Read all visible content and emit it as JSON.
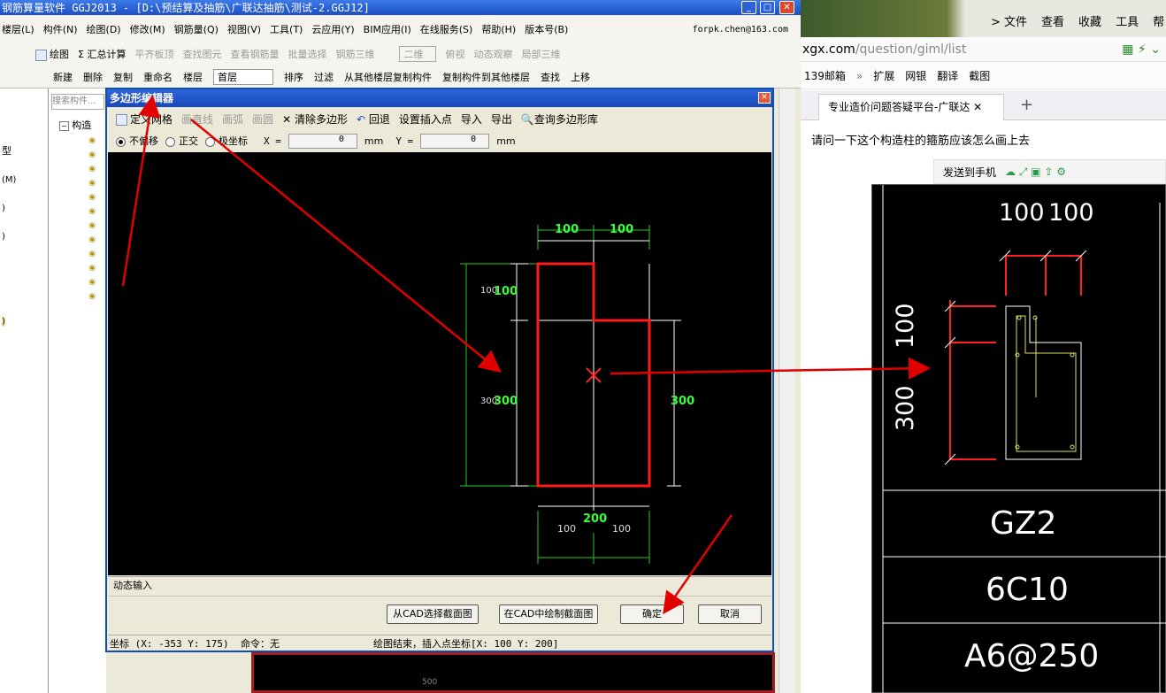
{
  "app": {
    "title": "钢筋算量软件 GGJ2013 - [D:\\预结算及抽筋\\广联达抽筋\\测试-2.GGJ12]",
    "menu": [
      "楼层(L)",
      "构件(N)",
      "绘图(D)",
      "修改(M)",
      "钢筋量(Q)",
      "视图(V)",
      "工具(T)",
      "云应用(Y)",
      "BIM应用(I)",
      "在线服务(S)",
      "帮助(H)",
      "版本号(B)"
    ],
    "account": "forpk.chen@163.com",
    "toolbar1": [
      "绘图",
      "Σ 汇总计算",
      "平齐板顶",
      "查找图元",
      "查看钢筋量",
      "批量选择",
      "钢筋三维",
      "二维",
      "俯视",
      "动态观察",
      "局部三维"
    ],
    "toolbar2": [
      "新建",
      "删除",
      "复制",
      "重命名",
      "楼层",
      "首层",
      "排序",
      "过滤",
      "从其他楼层复制构件",
      "复制构件到其他楼层",
      "查找",
      "上移"
    ],
    "search_placeholder": "搜索构件...",
    "tree_root": "构造",
    "left_labels": [
      "型",
      "(M)",
      ")",
      ")",
      ")"
    ]
  },
  "dialog": {
    "title": "多边形编辑器",
    "toolbar": [
      "定义网格",
      "画直线",
      "画弧",
      "画圆",
      "清除多边形",
      "回退",
      "设置插入点",
      "导入",
      "导出",
      "查询多边形库"
    ],
    "coord_modes": [
      "不偏移",
      "正交",
      "极坐标"
    ],
    "x_label": "X =",
    "x_value": "0",
    "y_label": "Y =",
    "y_value": "0",
    "unit": "mm",
    "dims": {
      "top_left": "100",
      "top_right": "100",
      "left_top": "100",
      "left_small_top": "100",
      "left_bottom": "300",
      "left_small_bottom": "300",
      "right": "300",
      "bottom": "200",
      "bottom_left": "100",
      "bottom_right": "100"
    },
    "dynamic_input": "动态输入",
    "buttons": {
      "select_cad": "从CAD选择截面图",
      "draw_cad": "在CAD中绘制截面图",
      "ok": "确定",
      "cancel": "取消"
    },
    "status_coord": "坐标 (X: -353 Y: 175)",
    "status_cmd": "命令：无",
    "status_msg": "绘图结束，插入点坐标[X: 100 Y: 200]",
    "bg_ruler": "500"
  },
  "browser": {
    "menu": [
      "> 文件",
      "查看",
      "收藏",
      "工具",
      "帮"
    ],
    "url_domain": "xgx.com",
    "url_path": "/question/giml/list",
    "bookmarks": [
      "139邮箱",
      "扩展",
      "网银",
      "翻译",
      "截图"
    ],
    "tab_title": "专业造价问题答疑平台-广联达",
    "question": "请问一下这个构造柱的箍筋应该怎么画上去",
    "send_to_phone": "发送到手机",
    "image": {
      "dim_top_a": "100",
      "dim_top_b": "100",
      "dim_left_a": "100",
      "dim_left_b": "300",
      "label_gz": "GZ2",
      "label_rebar": "6C10",
      "label_stirrup": "A6@250"
    }
  },
  "colors": {
    "shape": "#ff1a1a",
    "dim": "#22dd22",
    "dim_text": "#39ff39",
    "arrow": "#e00000"
  }
}
